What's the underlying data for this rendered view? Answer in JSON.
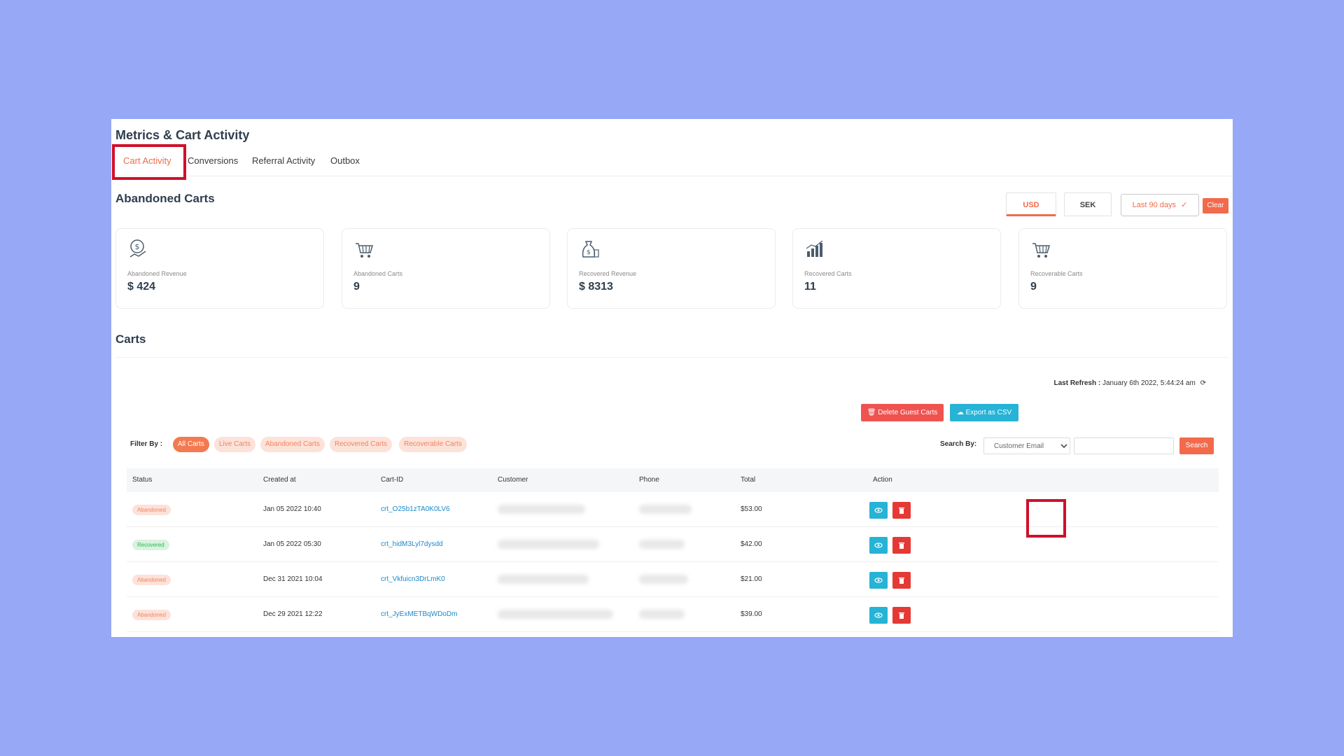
{
  "page": {
    "title": "Metrics & Cart Activity"
  },
  "tabs": [
    {
      "label": "Cart Activity",
      "active": true
    },
    {
      "label": "Conversions",
      "active": false
    },
    {
      "label": "Referral Activity",
      "active": false
    },
    {
      "label": "Outbox",
      "active": false
    }
  ],
  "abandoned": {
    "title": "Abandoned Carts",
    "currencies": [
      "USD",
      "SEK"
    ],
    "active_currency": "USD",
    "date_range": "Last 90 days",
    "clear_label": "Clear"
  },
  "metrics": [
    {
      "label": "Abandoned Revenue",
      "value": "$ 424",
      "icon": "dollar-hand-icon"
    },
    {
      "label": "Abandoned Carts",
      "value": "9",
      "icon": "cart-icon"
    },
    {
      "label": "Recovered Revenue",
      "value": "$ 8313",
      "icon": "money-bag-icon"
    },
    {
      "label": "Recovered Carts",
      "value": "11",
      "icon": "bar-chart-icon"
    },
    {
      "label": "Recoverable Carts",
      "value": "9",
      "icon": "cart-icon"
    }
  ],
  "carts": {
    "title": "Carts",
    "last_refresh_label": "Last Refresh :",
    "last_refresh_value": "January 6th 2022, 5:44:24 am",
    "delete_guest_label": "Delete Guest Carts",
    "export_label": "Export as CSV",
    "filter_label": "Filter By :",
    "filters": [
      {
        "label": "All Carts",
        "active": true
      },
      {
        "label": "Live Carts",
        "active": false
      },
      {
        "label": "Abandoned Carts",
        "active": false
      },
      {
        "label": "Recovered Carts",
        "active": false
      },
      {
        "label": "Recoverable Carts",
        "active": false
      }
    ],
    "search_label": "Search By:",
    "search_option": "Customer Email",
    "search_value": "",
    "search_button": "Search",
    "columns": [
      "Status",
      "Created at",
      "Cart-ID",
      "Customer",
      "Phone",
      "Total",
      "Action"
    ],
    "rows": [
      {
        "status": "Abandoned",
        "created_at": "Jan 05 2022 10:40",
        "cart_id": "crt_O25b1zTA0K0LV6",
        "total": "$53.00"
      },
      {
        "status": "Recovered",
        "created_at": "Jan 05 2022 05:30",
        "cart_id": "crt_hidM3Lyl7dysdd",
        "total": "$42.00"
      },
      {
        "status": "Abandoned",
        "created_at": "Dec 31 2021 10:04",
        "cart_id": "crt_Vkfuicn3DrLmK0",
        "total": "$21.00"
      },
      {
        "status": "Abandoned",
        "created_at": "Dec 29 2021 12:22",
        "cart_id": "crt_JyExMETBqWDoDm",
        "total": "$39.00"
      }
    ]
  },
  "colors": {
    "accent": "#f26a4b",
    "view": "#26b3d6",
    "delete": "#e53935",
    "highlight": "#d0102a",
    "background": "#96a8f6"
  }
}
